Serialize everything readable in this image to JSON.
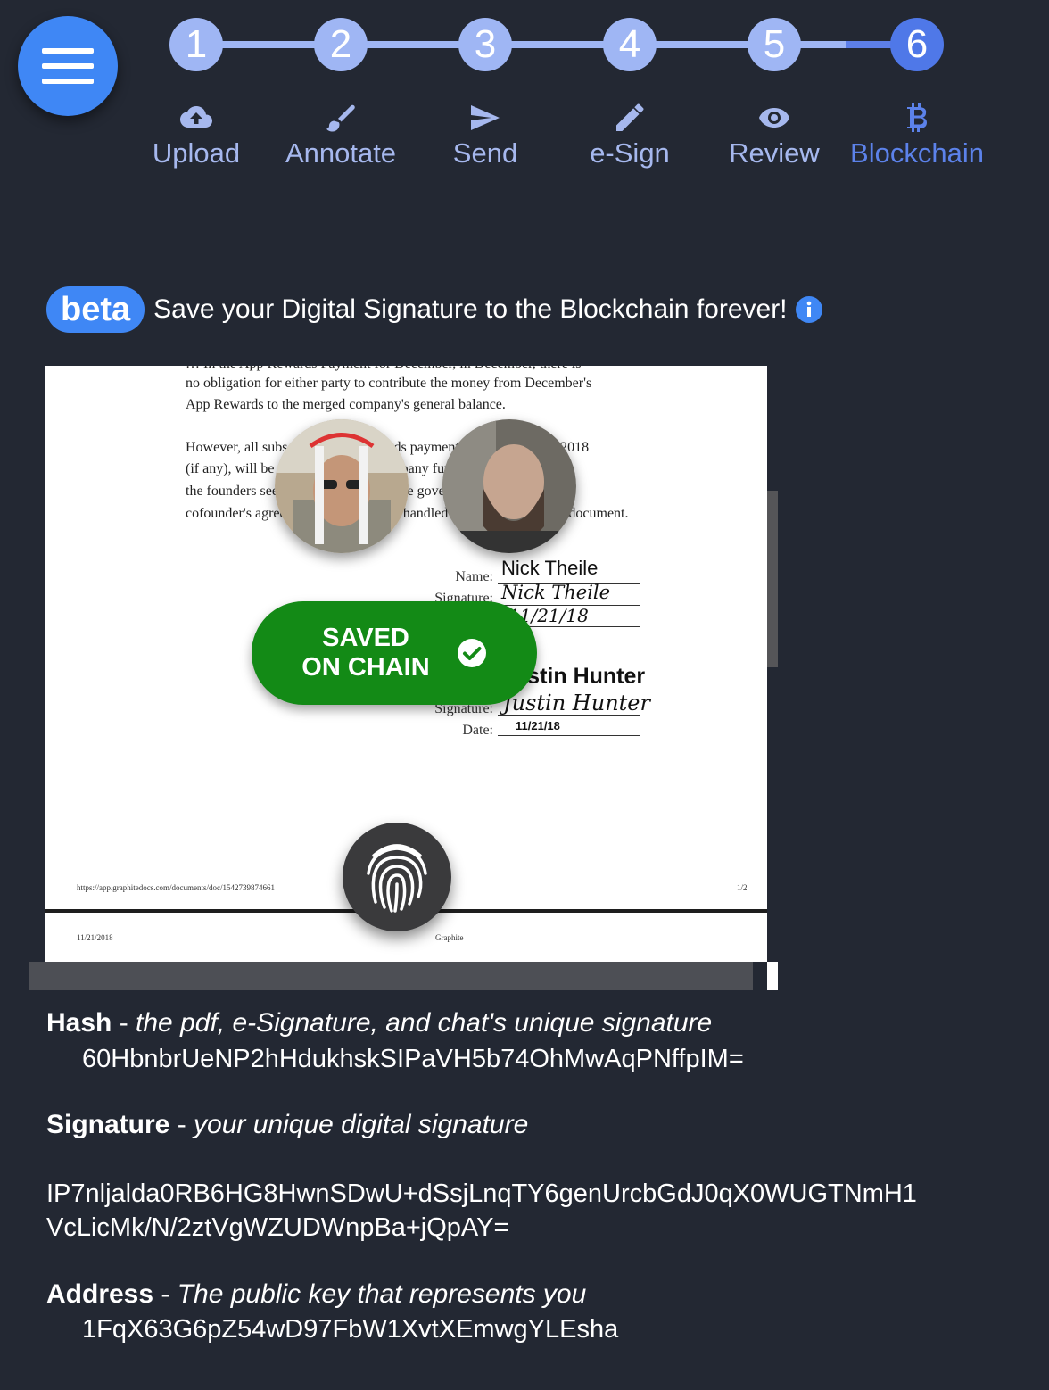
{
  "stepper": {
    "steps": [
      {
        "number": "1",
        "label": "Upload",
        "icon": "cloud-upload-icon"
      },
      {
        "number": "2",
        "label": "Annotate",
        "icon": "brush-icon"
      },
      {
        "number": "3",
        "label": "Send",
        "icon": "send-icon"
      },
      {
        "number": "4",
        "label": "e-Sign",
        "icon": "pencil-icon"
      },
      {
        "number": "5",
        "label": "Review",
        "icon": "eye-icon"
      },
      {
        "number": "6",
        "label": "Blockchain",
        "icon": "bitcoin-icon"
      }
    ],
    "current_step": 6
  },
  "beta": {
    "badge": "beta",
    "text": "Save your Digital Signature to the Blockchain forever!"
  },
  "document": {
    "top_cut_text": "… In the App Rewards Payment for December, in December, there is",
    "para1_line1": "no obligation for either party to contribute the money from December's",
    "para1_line2": "App Rewards to the merged company's general balance.",
    "para2_line1": "However, all subsequent App Rewards payments after December 2018",
    "para2_line2": "(if any), will be treated as shared company funds and distributed as",
    "para2_line3": "the founders see fit. These funds will be governed by the",
    "para2_line4": "cofounder's agreement, which will be handled separately from this document.",
    "name_label": "Name:",
    "signature_label": "Signature:",
    "date_label": "Date:",
    "signer1_name": "Nick Theile",
    "signer1_signature": "Nick Theile",
    "signer1_date": "11/21/18",
    "signer2_name": "Justin Hunter",
    "signer2_signature": "Justin Hunter",
    "signer2_date": "11/21/18",
    "footer_url": "https://app.graphitedocs.com/documents/doc/1542739874661",
    "footer_page": "1/2",
    "page2_date": "11/21/2018",
    "page2_brand": "Graphite"
  },
  "saved_pill": {
    "line1": "SAVED",
    "line2": "ON CHAIN",
    "color": "#138a16"
  },
  "details": {
    "hash_title": "Hash",
    "hash_desc": "the pdf, e-Signature, and chat's unique signature",
    "hash_value": "60HbnbrUeNP2hHdukhskSIPaVH5b74OhMwAqPNffpIM=",
    "signature_title": "Signature",
    "signature_desc": "your unique digital signature",
    "signature_value_line1": "IP7nljalda0RB6HG8HwnSDwU+dSsjLnqTY6genUrcbGdJ0qX0WUGTNmH1",
    "signature_value_line2": "VcLicMk/N/2ztVgWZUDWnpBa+jQpAY=",
    "address_title": "Address",
    "address_desc": "The public key that represents you",
    "address_value": "1FqX63G6pZ54wD97FbW1XvtXEmwgYLEsha",
    "separator": " - "
  },
  "colors": {
    "background": "#232833",
    "accent": "#3f87f5",
    "step_done": "#9fb6f4",
    "step_current": "#4f78e8",
    "step_label": "#a6b8ee"
  }
}
